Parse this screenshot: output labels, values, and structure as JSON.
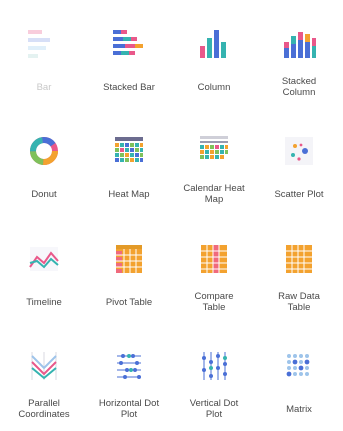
{
  "tiles": [
    {
      "key": "bar",
      "label": "Bar",
      "icon": "bar-chart-icon",
      "disabled": true
    },
    {
      "key": "stacked_bar",
      "label": "Stacked Bar",
      "icon": "stacked-bar-chart-icon"
    },
    {
      "key": "column",
      "label": "Column",
      "icon": "column-chart-icon"
    },
    {
      "key": "stacked_column",
      "label": "Stacked Column",
      "icon": "stacked-column-chart-icon"
    },
    {
      "key": "donut",
      "label": "Donut",
      "icon": "donut-chart-icon"
    },
    {
      "key": "heat_map",
      "label": "Heat Map",
      "icon": "heat-map-icon"
    },
    {
      "key": "calendar_heat_map",
      "label": "Calendar Heat Map",
      "icon": "calendar-heat-map-icon"
    },
    {
      "key": "scatter_plot",
      "label": "Scatter Plot",
      "icon": "scatter-plot-icon"
    },
    {
      "key": "timeline",
      "label": "Timeline",
      "icon": "timeline-chart-icon"
    },
    {
      "key": "pivot_table",
      "label": "Pivot Table",
      "icon": "pivot-table-icon"
    },
    {
      "key": "compare_table",
      "label": "Compare Table",
      "icon": "compare-table-icon"
    },
    {
      "key": "raw_data_table",
      "label": "Raw Data Table",
      "icon": "raw-data-table-icon"
    },
    {
      "key": "parallel_coordinates",
      "label": "Parallel Coordinates",
      "icon": "parallel-coordinates-icon"
    },
    {
      "key": "horizontal_dot_plot",
      "label": "Horizontal Dot Plot",
      "icon": "horizontal-dot-plot-icon"
    },
    {
      "key": "vertical_dot_plot",
      "label": "Vertical Dot Plot",
      "icon": "vertical-dot-plot-icon"
    },
    {
      "key": "matrix",
      "label": "Matrix",
      "icon": "matrix-icon"
    }
  ],
  "colors": {
    "blue": "#4a6fd6",
    "teal": "#35b3b0",
    "pink": "#e9588a",
    "orange": "#f3a22f",
    "green": "#7fc15b",
    "light_blue": "#9ec4ea",
    "gray_text": "#4a4a4a"
  }
}
